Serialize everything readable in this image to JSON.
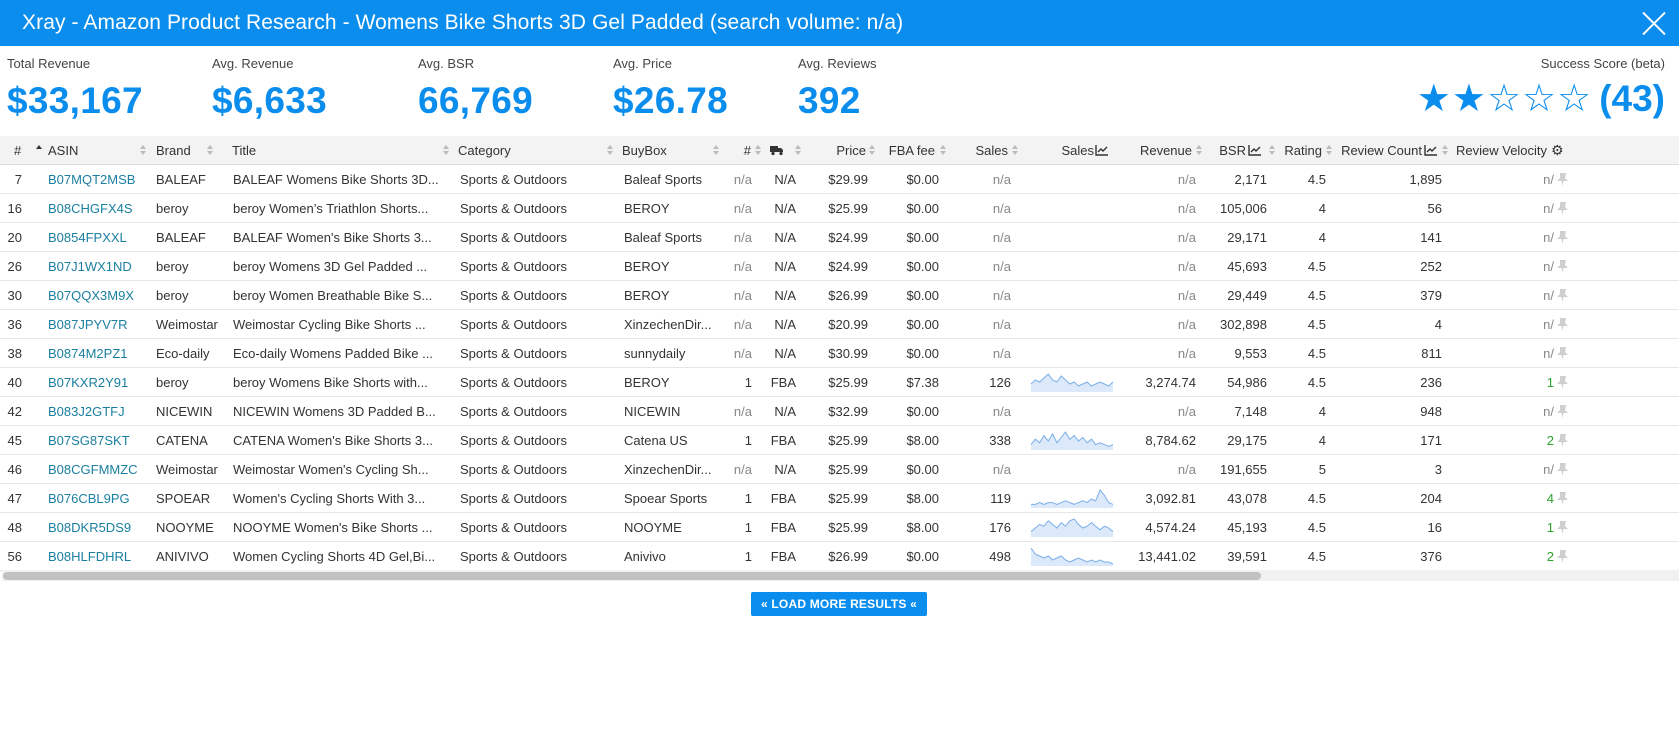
{
  "window": {
    "title": "Xray - Amazon Product Research - Womens Bike Shorts 3D Gel Padded (search volume: n/a)"
  },
  "stats": [
    {
      "label": "Total Revenue",
      "value": "$33,167"
    },
    {
      "label": "Avg. Revenue",
      "value": "$6,633"
    },
    {
      "label": "Avg. BSR",
      "value": "66,769"
    },
    {
      "label": "Avg. Price",
      "value": "$26.78"
    },
    {
      "label": "Avg. Reviews",
      "value": "392"
    }
  ],
  "success_score": {
    "label": "Success Score (beta)",
    "stars_filled": 2,
    "stars_total": 5,
    "value": "(43)"
  },
  "colors": {
    "accent": "#0a8ded",
    "asin_link": "#1a7fa0",
    "velocity_positive": "#2ca52c",
    "sparkline_stroke": "#7aaee8",
    "sparkline_fill": "#dbe9fb"
  },
  "table": {
    "columns": {
      "num": "#",
      "asin": "ASIN",
      "brand": "Brand",
      "title": "Title",
      "category": "Category",
      "buybox": "BuyBox",
      "sellers": "#",
      "fulfillment": "truck-icon",
      "price": "Price",
      "fba_fee": "FBA fee",
      "sales": "Sales",
      "sales_chart": "Sales",
      "revenue": "Revenue",
      "bsr": "BSR",
      "rating": "Rating",
      "review_count": "Review Count",
      "review_velocity": "Review Velocity"
    },
    "rows": [
      {
        "num": "7",
        "asin": "B07MQT2MSB",
        "brand": "BALEAF",
        "title": "BALEAF Womens Bike Shorts 3D...",
        "category": "Sports & Outdoors",
        "buybox": "Baleaf Sports",
        "sellers": "n/a",
        "fulfillment": "N/A",
        "price": "$29.99",
        "fba_fee": "$0.00",
        "sales": "n/a",
        "sales_trend": [],
        "revenue": "n/a",
        "bsr": "2,171",
        "rating": "4.5",
        "review_count": "1,895",
        "review_velocity": "n/"
      },
      {
        "num": "16",
        "asin": "B08CHGFX4S",
        "brand": "beroy",
        "title": "beroy Women’s Triathlon Shorts...",
        "category": "Sports & Outdoors",
        "buybox": "BEROY",
        "sellers": "n/a",
        "fulfillment": "N/A",
        "price": "$25.99",
        "fba_fee": "$0.00",
        "sales": "n/a",
        "sales_trend": [],
        "revenue": "n/a",
        "bsr": "105,006",
        "rating": "4",
        "review_count": "56",
        "review_velocity": "n/"
      },
      {
        "num": "20",
        "asin": "B0854FPXXL",
        "brand": "BALEAF",
        "title": "BALEAF Women's Bike Shorts 3...",
        "category": "Sports & Outdoors",
        "buybox": "Baleaf Sports",
        "sellers": "n/a",
        "fulfillment": "N/A",
        "price": "$24.99",
        "fba_fee": "$0.00",
        "sales": "n/a",
        "sales_trend": [],
        "revenue": "n/a",
        "bsr": "29,171",
        "rating": "4",
        "review_count": "141",
        "review_velocity": "n/"
      },
      {
        "num": "26",
        "asin": "B07J1WX1ND",
        "brand": "beroy",
        "title": "beroy Womens 3D Gel Padded ...",
        "category": "Sports & Outdoors",
        "buybox": "BEROY",
        "sellers": "n/a",
        "fulfillment": "N/A",
        "price": "$24.99",
        "fba_fee": "$0.00",
        "sales": "n/a",
        "sales_trend": [],
        "revenue": "n/a",
        "bsr": "45,693",
        "rating": "4.5",
        "review_count": "252",
        "review_velocity": "n/"
      },
      {
        "num": "30",
        "asin": "B07QQX3M9X",
        "brand": "beroy",
        "title": "beroy Women Breathable Bike S...",
        "category": "Sports & Outdoors",
        "buybox": "BEROY",
        "sellers": "n/a",
        "fulfillment": "N/A",
        "price": "$26.99",
        "fba_fee": "$0.00",
        "sales": "n/a",
        "sales_trend": [],
        "revenue": "n/a",
        "bsr": "29,449",
        "rating": "4.5",
        "review_count": "379",
        "review_velocity": "n/"
      },
      {
        "num": "36",
        "asin": "B087JPYV7R",
        "brand": "Weimostar",
        "title": "Weimostar Cycling Bike Shorts ...",
        "category": "Sports & Outdoors",
        "buybox": "XinzechenDir...",
        "sellers": "n/a",
        "fulfillment": "N/A",
        "price": "$20.99",
        "fba_fee": "$0.00",
        "sales": "n/a",
        "sales_trend": [],
        "revenue": "n/a",
        "bsr": "302,898",
        "rating": "4.5",
        "review_count": "4",
        "review_velocity": "n/"
      },
      {
        "num": "38",
        "asin": "B0874M2PZ1",
        "brand": "Eco-daily",
        "title": "Eco-daily Womens Padded Bike ...",
        "category": "Sports & Outdoors",
        "buybox": "sunnydaily",
        "sellers": "n/a",
        "fulfillment": "N/A",
        "price": "$30.99",
        "fba_fee": "$0.00",
        "sales": "n/a",
        "sales_trend": [],
        "revenue": "n/a",
        "bsr": "9,553",
        "rating": "4.5",
        "review_count": "811",
        "review_velocity": "n/"
      },
      {
        "num": "40",
        "asin": "B07KXR2Y91",
        "brand": "beroy",
        "title": "beroy Womens Bike Shorts with...",
        "category": "Sports & Outdoors",
        "buybox": "BEROY",
        "sellers": "1",
        "fulfillment": "FBA",
        "price": "$25.99",
        "fba_fee": "$7.38",
        "sales": "126",
        "sales_trend": [
          4,
          6,
          5,
          7,
          9,
          6,
          5,
          8,
          6,
          4,
          5,
          3,
          4,
          5,
          3,
          4,
          5,
          4,
          3,
          5
        ],
        "revenue": "3,274.74",
        "bsr": "54,986",
        "rating": "4.5",
        "review_count": "236",
        "review_velocity": "1"
      },
      {
        "num": "42",
        "asin": "B083J2GTFJ",
        "brand": "NICEWIN",
        "title": "NICEWIN Womens 3D Padded B...",
        "category": "Sports & Outdoors",
        "buybox": "NICEWIN",
        "sellers": "n/a",
        "fulfillment": "N/A",
        "price": "$32.99",
        "fba_fee": "$0.00",
        "sales": "n/a",
        "sales_trend": [],
        "revenue": "n/a",
        "bsr": "7,148",
        "rating": "4",
        "review_count": "948",
        "review_velocity": "n/"
      },
      {
        "num": "45",
        "asin": "B07SG87SKT",
        "brand": "CATENA",
        "title": "CATENA Women's Bike Shorts 3...",
        "category": "Sports & Outdoors",
        "buybox": "Catena US",
        "sellers": "1",
        "fulfillment": "FBA",
        "price": "$25.99",
        "fba_fee": "$8.00",
        "sales": "338",
        "sales_trend": [
          3,
          6,
          4,
          8,
          5,
          9,
          4,
          7,
          10,
          6,
          8,
          5,
          7,
          4,
          6,
          3,
          4,
          3,
          2,
          3
        ],
        "revenue": "8,784.62",
        "bsr": "29,175",
        "rating": "4",
        "review_count": "171",
        "review_velocity": "2"
      },
      {
        "num": "46",
        "asin": "B08CGFMMZC",
        "brand": "Weimostar",
        "title": "Weimostar Women's Cycling Sh...",
        "category": "Sports & Outdoors",
        "buybox": "XinzechenDir...",
        "sellers": "n/a",
        "fulfillment": "N/A",
        "price": "$25.99",
        "fba_fee": "$0.00",
        "sales": "n/a",
        "sales_trend": [],
        "revenue": "n/a",
        "bsr": "191,655",
        "rating": "5",
        "review_count": "3",
        "review_velocity": "n/"
      },
      {
        "num": "47",
        "asin": "B076CBL9PG",
        "brand": "SPOEAR",
        "title": "Women's Cycling Shorts With 3...",
        "category": "Sports & Outdoors",
        "buybox": "Spoear Sports",
        "sellers": "1",
        "fulfillment": "FBA",
        "price": "$25.99",
        "fba_fee": "$8.00",
        "sales": "119",
        "sales_trend": [
          2,
          2,
          3,
          2,
          3,
          3,
          2,
          3,
          4,
          3,
          2,
          3,
          4,
          3,
          5,
          4,
          10,
          7,
          3,
          2
        ],
        "revenue": "3,092.81",
        "bsr": "43,078",
        "rating": "4.5",
        "review_count": "204",
        "review_velocity": "4"
      },
      {
        "num": "48",
        "asin": "B08DKR5DS9",
        "brand": "NOOYME",
        "title": "NOOYME Women's Bike Shorts ...",
        "category": "Sports & Outdoors",
        "buybox": "NOOYME",
        "sellers": "1",
        "fulfillment": "FBA",
        "price": "$25.99",
        "fba_fee": "$8.00",
        "sales": "176",
        "sales_trend": [
          3,
          5,
          7,
          6,
          9,
          7,
          5,
          8,
          6,
          9,
          10,
          7,
          5,
          6,
          8,
          6,
          4,
          6,
          5,
          3
        ],
        "revenue": "4,574.24",
        "bsr": "45,193",
        "rating": "4.5",
        "review_count": "16",
        "review_velocity": "1"
      },
      {
        "num": "56",
        "asin": "B08HLFDHRL",
        "brand": "ANIVIVO",
        "title": "Women Cycling Shorts 4D Gel,Bi...",
        "category": "Sports & Outdoors",
        "buybox": "Anivivo",
        "sellers": "1",
        "fulfillment": "FBA",
        "price": "$26.99",
        "fba_fee": "$0.00",
        "sales": "498",
        "sales_trend": [
          9,
          6,
          5,
          4,
          5,
          3,
          4,
          5,
          3,
          2,
          3,
          4,
          3,
          2,
          3,
          2,
          3,
          2,
          2,
          1
        ],
        "revenue": "13,441.02",
        "bsr": "39,591",
        "rating": "4.5",
        "review_count": "376",
        "review_velocity": "2"
      }
    ]
  },
  "load_more": {
    "label": "LOAD MORE RESULTS",
    "icon": "double-chevron-up-icon"
  },
  "icons": {
    "close": "close-icon",
    "pin": "pin-icon",
    "chart": "line-chart-icon",
    "settings": "gear-icon",
    "truck": "truck-icon"
  }
}
